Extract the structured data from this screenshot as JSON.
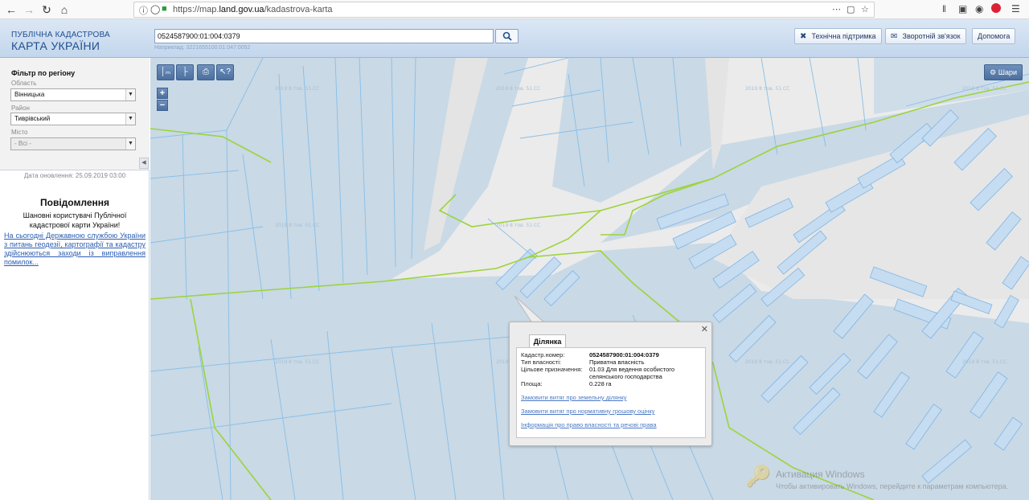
{
  "browser": {
    "url_prefix": "https://map.",
    "url_domain": "land.gov.ua",
    "url_path": "/kadastrova-karta"
  },
  "header": {
    "logo_line1": "ПУБЛІЧНА КАДАСТРОВА",
    "logo_line2": "КАРТА УКРАЇНИ",
    "search_value": "0524587900:01:004:0379",
    "search_hint": "Наприклад: 3221655100:01:047:0052",
    "buttons": {
      "support": "Технічна підтримка",
      "feedback": "Зворотній зв'язок",
      "help": "Допомога"
    }
  },
  "filter": {
    "title": "Фільтр по регіону",
    "region_label": "Область",
    "region_value": "Вінницька",
    "district_label": "Район",
    "district_value": "Тиврівський",
    "city_label": "Місто",
    "city_value": "- Всі -"
  },
  "update_date": "Дата оновлення: 25.09.2019 03:00",
  "notice": {
    "title": "Повідомлення",
    "greeting": "Шановні користувачі Публічної кадастрової карти України!",
    "link_text": "На сьогодні Державною службою України з питань геодезії, картографії та кадастру здійснюються заходи із виправлення помилок..."
  },
  "map": {
    "layers_label": "Шари",
    "zoom_in": "+",
    "zoom_out": "−"
  },
  "popup": {
    "tab_label": "Ділянка",
    "rows": [
      {
        "label": "Кадастр.номер:",
        "value": "0524587900:01:004:0379"
      },
      {
        "label": "Тип власності:",
        "value": "Приватна власність"
      },
      {
        "label": "Цільове призначення:",
        "value": "01.03 Для ведення особистого селянського господарства"
      },
      {
        "label": "Площа:",
        "value": "0.228 га"
      }
    ],
    "links": [
      "Замовити витяг про земельну ділянку",
      "Замовити витяг про нормативну грошову оцінку",
      "Інформація про право власності та речові права"
    ]
  },
  "watermark": {
    "title": "Активация Windows",
    "subtitle": "Чтобы активировать Windows, перейдите к параметрам компьютера."
  }
}
